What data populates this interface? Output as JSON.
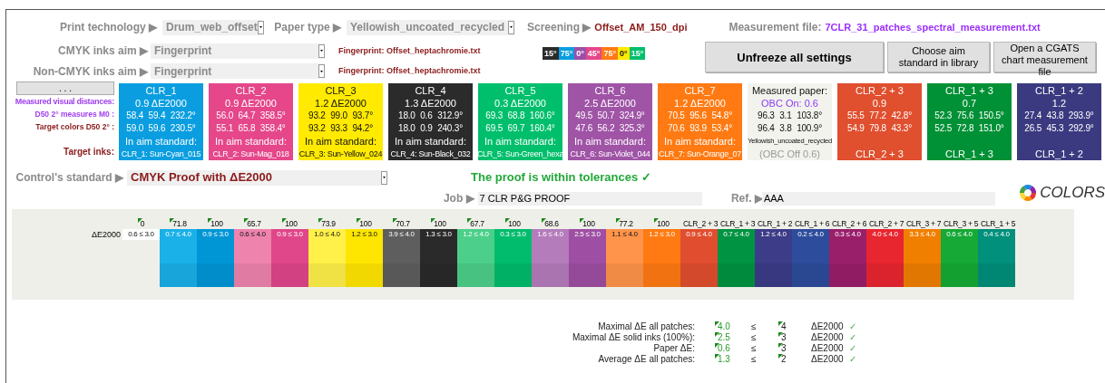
{
  "settings": {
    "print_technology": {
      "label": "Print technology ▶",
      "value": "Drum_web_offset"
    },
    "paper_type": {
      "label": "Paper type ▶",
      "value": "Yellowish_uncoated_recycled"
    },
    "screening": {
      "label": "Screening ▶",
      "value": "Offset_AM_150_dpi"
    },
    "measurement_file": {
      "label": "Measurement file:",
      "value": "7CLR_31_patches_spectral_measurement.txt"
    },
    "cmyk_inks_aim": {
      "label": "CMYK inks aim ▶",
      "value": "Fingerprint",
      "note": "Fingerprint: Offset_heptachromie.txt"
    },
    "non_cmyk_inks_aim": {
      "label": "Non-CMYK inks aim ▶",
      "value": "Fingerprint",
      "note": "Fingerprint: Offset_heptachromie.txt"
    }
  },
  "screening_angles": [
    {
      "label": "15°",
      "color": "#2b2b2b"
    },
    {
      "label": "75°",
      "color": "#0a9ee0"
    },
    {
      "label": "0°",
      "color": "#9c4fa8"
    },
    {
      "label": "45°",
      "color": "#e5478a"
    },
    {
      "label": "75°",
      "color": "#ff7a12"
    },
    {
      "label": "0°",
      "color": "#ffea00"
    },
    {
      "label": "15°",
      "color": "#00bf6c"
    }
  ],
  "buttons": [
    "Unfreeze all settings",
    "Choose aim standard in library",
    "Open a CGATS chart measurement file"
  ],
  "more_button": ". . .",
  "row_labels": {
    "visual": "Measured visual distances:",
    "measures": "D50 2° measures M0 :",
    "targets": "Target colors D50 2° :",
    "inks": "Target inks:"
  },
  "patches": [
    {
      "kind": "ink",
      "title": "CLR_1",
      "delta": "0.9 ΔE2000",
      "measured": [
        "58.4",
        "59.4",
        "232.2°"
      ],
      "target": [
        "59.0",
        "59.6",
        "230.5°"
      ],
      "aim": "In aim standard:",
      "ink": "CLR_1: Sun-Cyan_015",
      "color": "#0a9ee0"
    },
    {
      "kind": "ink",
      "title": "CLR_2",
      "delta": "0.9 ΔE2000",
      "measured": [
        "56.0",
        "64.7",
        "358.5°"
      ],
      "target": [
        "55.1",
        "65.8",
        "358.4°"
      ],
      "aim": "In aim standard:",
      "ink": "CLR_2: Sun-Mag_018",
      "color": "#e5478a"
    },
    {
      "kind": "ink",
      "title": "CLR_3",
      "delta": "1.2 ΔE2000",
      "measured": [
        "93.2",
        "99.0",
        "93.7°"
      ],
      "target": [
        "93.2",
        "93.3",
        "94.2°"
      ],
      "aim": "In aim standard:",
      "ink": "CLR_3: Sun-Yellow_024",
      "color": "#ffea00"
    },
    {
      "kind": "ink",
      "title": "CLR_4",
      "delta": "1.3 ΔE2000",
      "measured": [
        "18.0",
        "0.6",
        "312.9°"
      ],
      "target": [
        "18.0",
        "0.9",
        "240.3°"
      ],
      "aim": "In aim standard:",
      "ink": "CLR_4: Sun-Black_032",
      "color": "#2b2b2b"
    },
    {
      "kind": "ink",
      "title": "CLR_5",
      "delta": "0.3 ΔE2000",
      "measured": [
        "69.3",
        "68.8",
        "160.6°"
      ],
      "target": [
        "69.5",
        "69.7",
        "160.4°"
      ],
      "aim": "In aim standard:",
      "ink": "CLR_5: Sun-Green_hexa",
      "color": "#00bf6c"
    },
    {
      "kind": "ink",
      "title": "CLR_6",
      "delta": "2.5 ΔE2000",
      "measured": [
        "49.5",
        "50.7",
        "324.9°"
      ],
      "target": [
        "47.6",
        "56.2",
        "325.3°"
      ],
      "aim": "In aim standard:",
      "ink": "CLR_6: Sun-Violet_044",
      "color": "#9f54a6"
    },
    {
      "kind": "ink",
      "title": "CLR_7",
      "delta": "1.2 ΔE2000",
      "measured": [
        "70.5",
        "95.6",
        "54.8°"
      ],
      "target": [
        "70.6",
        "93.9",
        "53.4°"
      ],
      "aim": "In aim standard:",
      "ink": "CLR_7: Sun-Orange_07",
      "color": "#ff7a12"
    },
    {
      "kind": "paper",
      "title": "Measured paper:",
      "obc_on": "OBC On: 0.6",
      "measured": [
        "96.3",
        "3.1",
        "103.8°"
      ],
      "target": [
        "96.4",
        "3.8",
        "100.9°"
      ],
      "paper": "Yellowish_uncoated_recycled",
      "obc_off": "(OBC Off 0.6)",
      "color": "#f3f3ee"
    },
    {
      "kind": "overprint",
      "title": "CLR_2 + 3",
      "delta": "0.9",
      "measured": [
        "55.5",
        "77.2",
        "42.8°"
      ],
      "target": [
        "54.9",
        "79.8",
        "43.3°"
      ],
      "footer": "CLR_2 + 3",
      "color": "#e04f2e"
    },
    {
      "kind": "overprint",
      "title": "CLR_1 + 3",
      "delta": "0.7",
      "measured": [
        "52.3",
        "75.6",
        "150.5°"
      ],
      "target": [
        "52.5",
        "72.8",
        "151.0°"
      ],
      "footer": "CLR_1 + 3",
      "color": "#009136"
    },
    {
      "kind": "overprint",
      "title": "CLR_1 + 2",
      "delta": "1.2",
      "measured": [
        "27.4",
        "43.8",
        "293.9°"
      ],
      "target": [
        "26.5",
        "45.3",
        "292.9°"
      ],
      "footer": "CLR_1 + 2",
      "color": "#3b3a80"
    }
  ],
  "control": {
    "label": "Control's standard ▶",
    "value": "CMYK Proof with ΔE2000",
    "verdict": "The proof is within tolerances ✓"
  },
  "job": {
    "label": "Job ▶",
    "value": "7 CLR P&G PROOF"
  },
  "ref": {
    "label": "Ref. ▶",
    "value": "AAA"
  },
  "logo_text": "COLORS",
  "delta_table": {
    "label": "ΔE2000",
    "columns": [
      {
        "heading": "0",
        "value": "0.6 ≤ 3.0",
        "flagged": true
      },
      {
        "heading": "71.8",
        "value": "0.7 ≤ 4.0",
        "flagged": true,
        "color": "#1ab0e8"
      },
      {
        "heading": "100",
        "value": "0.9 ≤ 3.0",
        "flagged": true,
        "color": "#0096d6"
      },
      {
        "heading": "65.7",
        "value": "0.6 ≤ 4.0",
        "flagged": true,
        "color": "#ee83ae"
      },
      {
        "heading": "100",
        "value": "0.9 ≤ 3.0",
        "flagged": true,
        "color": "#e0468a"
      },
      {
        "heading": "73.9",
        "value": "1.0 ≤ 4.0",
        "flagged": true,
        "color": "#fff04a"
      },
      {
        "heading": "100",
        "value": "1.2 ≤ 3.0",
        "flagged": true,
        "color": "#ffe600"
      },
      {
        "heading": "70.7",
        "value": "3.9 ≤ 4.0",
        "flagged": true,
        "color": "#5e5e5e"
      },
      {
        "heading": "100",
        "value": "1.3 ≤ 3.0",
        "flagged": true,
        "color": "#2a2a2a"
      },
      {
        "heading": "67.7",
        "value": "1.2 ≤ 4.0",
        "flagged": true,
        "color": "#4ccf8a"
      },
      {
        "heading": "100",
        "value": "0.3 ≤ 3.0",
        "flagged": true,
        "color": "#00bc6c"
      },
      {
        "heading": "68.6",
        "value": "1.6 ≤ 4.0",
        "flagged": true,
        "color": "#b47cbb"
      },
      {
        "heading": "100",
        "value": "2.5 ≤ 3.0",
        "flagged": true,
        "color": "#9f4fa3"
      },
      {
        "heading": "77.2",
        "value": "1.1 ≤ 4.0",
        "flagged": true,
        "color": "#ff944a"
      },
      {
        "heading": "100",
        "value": "1.2 ≤ 3.0",
        "flagged": true,
        "color": "#ff7a12"
      },
      {
        "heading": "CLR_2 + 3",
        "value": "0.9 ≤ 4.0",
        "flagged": false,
        "color": "#e14e2f"
      },
      {
        "heading": "CLR_1 + 3",
        "value": "0.7 ≤ 4.0",
        "flagged": false,
        "color": "#009342"
      },
      {
        "heading": "CLR_1 + 2",
        "value": "1.2 ≤ 4.0",
        "flagged": false,
        "color": "#3c3c88"
      },
      {
        "heading": "CLR_1 + 6",
        "value": "0.2 ≤ 4.0",
        "flagged": false,
        "color": "#2d4c9c"
      },
      {
        "heading": "CLR_2 + 6",
        "value": "0.3 ≤ 4.0",
        "flagged": false,
        "color": "#9a1f6b"
      },
      {
        "heading": "CLR_2 + 7",
        "value": "4.0 ≤ 4.0",
        "flagged": false,
        "color": "#e8262f"
      },
      {
        "heading": "CLR_3 + 7",
        "value": "3.3 ≤ 4.0",
        "flagged": false,
        "color": "#f07f00"
      },
      {
        "heading": "CLR_3 + 5",
        "value": "0.6 ≤ 4.0",
        "flagged": false,
        "color": "#16a935"
      },
      {
        "heading": "CLR_1 + 5",
        "value": "0.4 ≤ 4.0",
        "flagged": false,
        "color": "#00907c"
      }
    ]
  },
  "summary": [
    {
      "label": "Maximal ΔE all patches:",
      "value": "4.0",
      "op": "≤",
      "limit": "4",
      "unit": "ΔE2000",
      "check": "✓",
      "flagged": true
    },
    {
      "label": "Maximal ΔE solid inks (100%):",
      "value": "2.5",
      "op": "≤",
      "limit": "3",
      "unit": "ΔE2000",
      "check": "✓",
      "flagged": true
    },
    {
      "label": "Paper ΔE:",
      "value": "0.6",
      "op": "≤",
      "limit": "3",
      "unit": "ΔE2000",
      "check": "✓",
      "flagged": true
    },
    {
      "label": "Average ΔE all patches:",
      "value": "1.3",
      "op": "≤",
      "limit": "2",
      "unit": "ΔE2000",
      "check": "✓",
      "flagged": true
    }
  ]
}
